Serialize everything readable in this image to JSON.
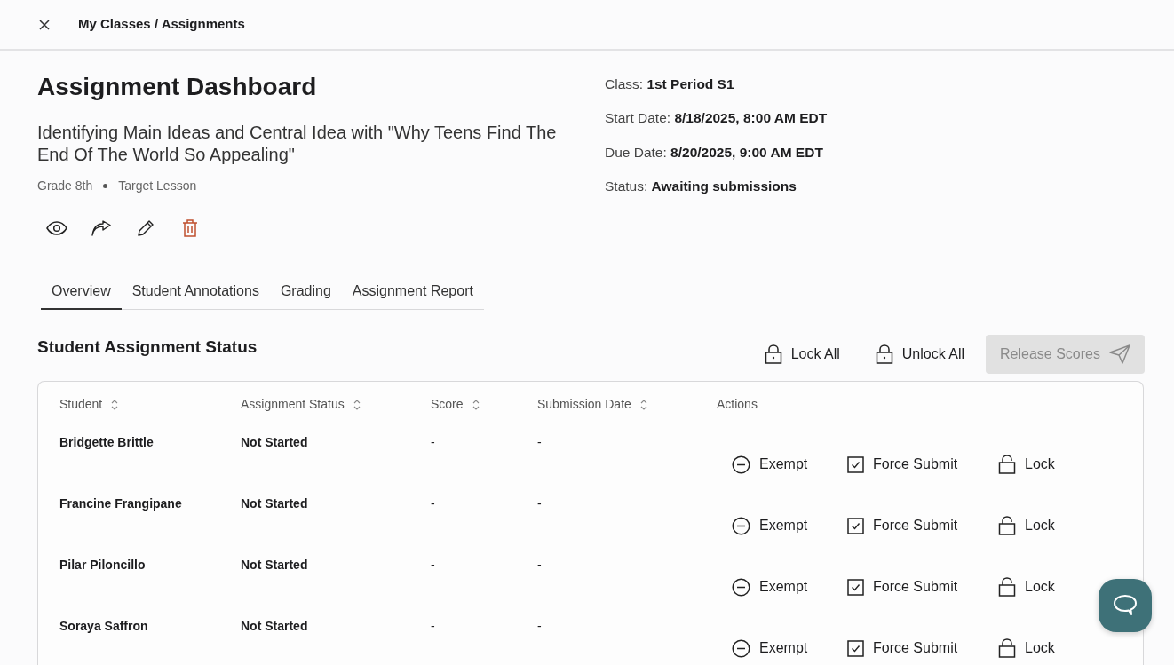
{
  "header": {
    "breadcrumb": "My Classes / Assignments"
  },
  "page_title": "Assignment Dashboard",
  "assignment_title": "Identifying Main Ideas and Central Idea with \"Why Teens Find The End Of The World So Appealing\"",
  "meta": [
    "Grade 8th",
    "Target Lesson"
  ],
  "details": [
    "Class: **1st Period S1**",
    "Start Date: **8/18/2025, 8:00 AM EDT**",
    "Due Date: **8/20/2025, 9:00 AM EDT**",
    "Status: **Awaiting submissions**"
  ],
  "tabs": [
    {
      "label": "Overview",
      "selected": true
    },
    {
      "label": "Student Annotations",
      "selected": false
    },
    {
      "label": "Grading",
      "selected": false
    },
    {
      "label": "Assignment Report",
      "selected": false
    }
  ],
  "section_title": "Student Assignment Status",
  "bulk_actions": [
    {
      "kind": "lock",
      "label": "Lock All",
      "disabled": false
    },
    {
      "kind": "unlock",
      "label": "Unlock All",
      "disabled": false
    },
    {
      "kind": "release",
      "label": "Release Scores",
      "disabled": true
    }
  ],
  "table": {
    "columns": [
      {
        "label": "Student",
        "sortable": true
      },
      {
        "label": "Assignment Status",
        "sortable": true
      },
      {
        "label": "Score",
        "sortable": true
      },
      {
        "label": "Submission Date",
        "sortable": true
      },
      {
        "label": "Actions",
        "sortable": false
      }
    ],
    "rows": [
      {
        "student": "Bridgette Brittle",
        "status": "Not Started",
        "score": "-",
        "submission_date": "-",
        "actions": [
          "Exempt",
          "Force Submit",
          "Lock"
        ]
      },
      {
        "student": "Francine Frangipane",
        "status": "Not Started",
        "score": "-",
        "submission_date": "-",
        "actions": [
          "Exempt",
          "Force Submit",
          "Lock"
        ]
      },
      {
        "student": "Pilar Piloncillo",
        "status": "Not Started",
        "score": "-",
        "submission_date": "-",
        "actions": [
          "Exempt",
          "Force Submit",
          "Lock"
        ]
      },
      {
        "student": "Soraya Saffron",
        "status": "Not Started",
        "score": "-",
        "submission_date": "-",
        "actions": [
          "Exempt",
          "Force Submit",
          "Lock"
        ]
      }
    ]
  }
}
